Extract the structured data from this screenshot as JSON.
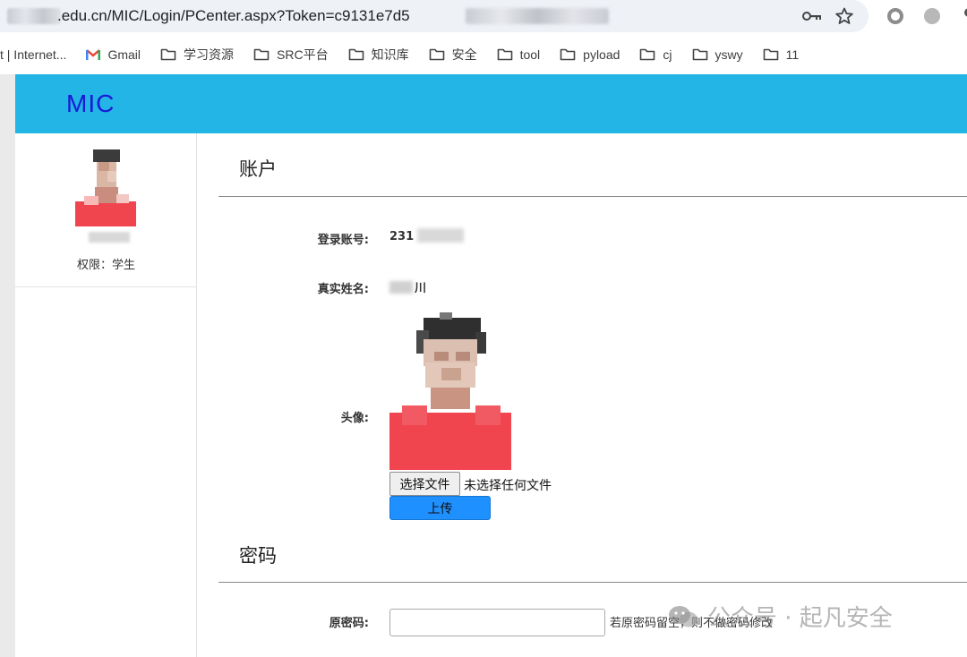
{
  "browser": {
    "url": ".edu.cn/MIC/Login/PCenter.aspx?Token=c9131e7d5",
    "bookmarks": [
      {
        "label": "t | Internet...",
        "kind": "text"
      },
      {
        "label": "Gmail",
        "kind": "gmail"
      },
      {
        "label": "学习资源",
        "kind": "folder"
      },
      {
        "label": "SRC平台",
        "kind": "folder"
      },
      {
        "label": "知识库",
        "kind": "folder"
      },
      {
        "label": "安全",
        "kind": "folder"
      },
      {
        "label": "tool",
        "kind": "folder"
      },
      {
        "label": "pyload",
        "kind": "folder"
      },
      {
        "label": "cj",
        "kind": "folder"
      },
      {
        "label": "yswy",
        "kind": "folder"
      },
      {
        "label": "11",
        "kind": "folder"
      }
    ]
  },
  "header": {
    "brand": "MIC",
    "color": "#22b5e5"
  },
  "sidebar": {
    "role": "权限：学生"
  },
  "account": {
    "title": "账户",
    "login_label": "登录账号:",
    "login_value": "231",
    "name_label": "真实姓名:",
    "name_value": "川",
    "avatar_label": "头像:",
    "file_button": "选择文件",
    "file_status": "未选择任何文件",
    "upload_button": "上传"
  },
  "password": {
    "title": "密码",
    "old_label": "原密码:",
    "old_hint": "若原密码留空，则不做密码修改"
  },
  "watermark": "公众号 · 起凡安全"
}
